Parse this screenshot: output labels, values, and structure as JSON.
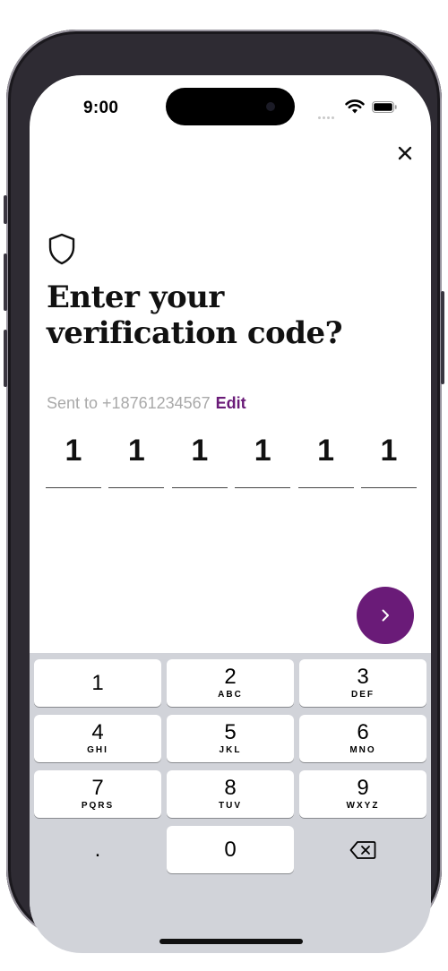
{
  "status": {
    "time": "9:00"
  },
  "header": {
    "close_icon": "close-icon"
  },
  "main": {
    "icon": "shield-icon",
    "title": "Enter your verification code?",
    "sent_prefix": "Sent to +18761234567",
    "edit_label": "Edit",
    "code_digits": [
      "1",
      "1",
      "1",
      "1",
      "1",
      "1"
    ],
    "next_icon": "chevron-right-icon",
    "accent_color": "#6a1b78"
  },
  "keyboard": {
    "keys": [
      {
        "num": "1",
        "letters": ""
      },
      {
        "num": "2",
        "letters": "ABC"
      },
      {
        "num": "3",
        "letters": "DEF"
      },
      {
        "num": "4",
        "letters": "GHI"
      },
      {
        "num": "5",
        "letters": "JKL"
      },
      {
        "num": "6",
        "letters": "MNO"
      },
      {
        "num": "7",
        "letters": "PQRS"
      },
      {
        "num": "8",
        "letters": "TUV"
      },
      {
        "num": "9",
        "letters": "WXYZ"
      },
      {
        "num": ".",
        "letters": ""
      },
      {
        "num": "0",
        "letters": ""
      }
    ],
    "delete_icon": "backspace-icon"
  }
}
